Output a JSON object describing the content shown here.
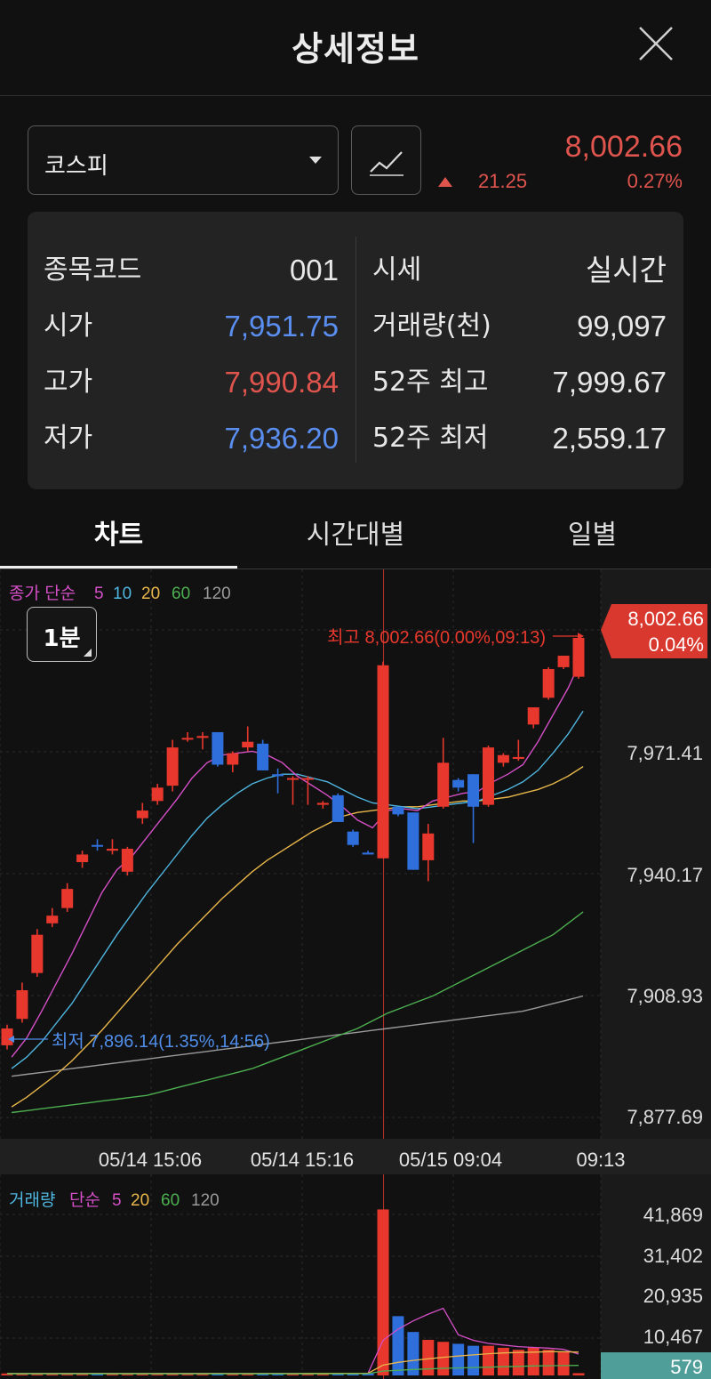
{
  "header": {
    "title": "상세정보"
  },
  "selector": {
    "index_name": "코스피"
  },
  "quote": {
    "price": "8,002.66",
    "change": "21.25",
    "change_pct": "0.27%"
  },
  "info": {
    "left": [
      {
        "key": "종목코드",
        "value": "001",
        "color": "white"
      },
      {
        "key": "시가",
        "value": "7,951.75",
        "color": "blue"
      },
      {
        "key": "고가",
        "value": "7,990.84",
        "color": "red"
      },
      {
        "key": "저가",
        "value": "7,936.20",
        "color": "blue"
      }
    ],
    "right": [
      {
        "key": "시세",
        "value": "실시간"
      },
      {
        "key": "거래량(천)",
        "value": "99,097"
      },
      {
        "key": "52주 최고",
        "value": "7,999.67"
      },
      {
        "key": "52주 최저",
        "value": "2,559.17"
      }
    ]
  },
  "tabs": [
    "차트",
    "시간대별",
    "일별"
  ],
  "price_chart": {
    "legend": {
      "prefix": "종가 단순",
      "periods": [
        "5",
        "10",
        "20",
        "60",
        "120"
      ]
    },
    "period_button": "1분",
    "current": {
      "price": "8,002.66",
      "pct": "0.04%"
    },
    "high_note": "최고 8,002.66(0.00%,09:13)",
    "low_note": "최저 7,896.14(1.35%,14:56)",
    "y_ticks": [
      "7,971.41",
      "7,940.17",
      "7,908.93",
      "7,877.69"
    ],
    "x_ticks": [
      "05/14 15:06",
      "05/14 15:16",
      "05/15 09:04",
      "09:13"
    ]
  },
  "volume_chart": {
    "legend": {
      "prefix": "거래량",
      "prefix2": "단순",
      "periods": [
        "5",
        "20",
        "60",
        "120"
      ]
    },
    "y_ticks": [
      "41,869",
      "31,402",
      "20,935",
      "10,467"
    ],
    "current": "579"
  },
  "colors": {
    "up": "#e8382d",
    "down": "#2f6fdc",
    "ma5": "#d44fc6",
    "ma10": "#4fb6e0",
    "ma20": "#e8b64a",
    "ma60": "#4caf50",
    "ma120": "#9a9a9a"
  },
  "chart_data": [
    {
      "type": "candlestick",
      "title": "",
      "y_axis": {
        "min": 7877.69,
        "max": 8002.66,
        "ticks": [
          7971.41,
          7940.17,
          7908.93,
          7877.69
        ]
      },
      "x_ticks": [
        "05/14 15:06",
        "05/14 15:16",
        "05/15 09:04",
        "09:13"
      ],
      "candles": [
        {
          "o": 7896.1,
          "h": 7901.5,
          "l": 7895.0,
          "c": 7900.5
        },
        {
          "o": 7903.0,
          "h": 7912.5,
          "l": 7902.0,
          "c": 7910.5
        },
        {
          "o": 7915.0,
          "h": 7926.5,
          "l": 7914.0,
          "c": 7925.0
        },
        {
          "o": 7928.0,
          "h": 7932.0,
          "l": 7927.0,
          "c": 7930.0
        },
        {
          "o": 7932.0,
          "h": 7938.5,
          "l": 7931.0,
          "c": 7937.0
        },
        {
          "o": 7944.0,
          "h": 7947.0,
          "l": 7942.5,
          "c": 7946.0
        },
        {
          "o": 7948.5,
          "h": 7950.0,
          "l": 7947.0,
          "c": 7948.3
        },
        {
          "o": 7947.0,
          "h": 7950.0,
          "l": 7946.0,
          "c": 7947.5
        },
        {
          "o": 7941.5,
          "h": 7948.0,
          "l": 7940.5,
          "c": 7947.5
        },
        {
          "o": 7955.5,
          "h": 7959.5,
          "l": 7954.0,
          "c": 7957.5
        },
        {
          "o": 7960.0,
          "h": 7964.5,
          "l": 7959.0,
          "c": 7963.5
        },
        {
          "o": 7964.0,
          "h": 7976.0,
          "l": 7962.5,
          "c": 7974.0
        },
        {
          "o": 7976.5,
          "h": 7978.0,
          "l": 7975.5,
          "c": 7976.5
        },
        {
          "o": 7976.5,
          "h": 7978.0,
          "l": 7973.5,
          "c": 7977.0
        },
        {
          "o": 7978.0,
          "h": 7978.0,
          "l": 7969.0,
          "c": 7969.5
        },
        {
          "o": 7969.5,
          "h": 7973.0,
          "l": 7967.5,
          "c": 7972.5
        },
        {
          "o": 7974.0,
          "h": 7979.5,
          "l": 7973.0,
          "c": 7975.5
        },
        {
          "o": 7975.0,
          "h": 7976.0,
          "l": 7968.0,
          "c": 7968.0
        },
        {
          "o": 7967.0,
          "h": 7968.5,
          "l": 7962.0,
          "c": 7966.5
        },
        {
          "o": 7966.0,
          "h": 7966.5,
          "l": 7959.0,
          "c": 7966.0
        },
        {
          "o": 7966.0,
          "h": 7966.5,
          "l": 7959.0,
          "c": 7966.0
        },
        {
          "o": 7959.0,
          "h": 7960.0,
          "l": 7958.0,
          "c": 7959.5
        },
        {
          "o": 7961.5,
          "h": 7962.0,
          "l": 7954.5,
          "c": 7954.5
        },
        {
          "o": 7952.0,
          "h": 7952.5,
          "l": 7948.0,
          "c": 7948.5
        },
        {
          "o": 7946.5,
          "h": 7947.0,
          "l": 7946.0,
          "c": 7946.0
        },
        {
          "o": 7945.0,
          "h": 7996.5,
          "l": 7945.0,
          "c": 7995.5
        },
        {
          "o": 7958.5,
          "h": 7958.5,
          "l": 7956.0,
          "c": 7956.5
        },
        {
          "o": 7957.0,
          "h": 7957.0,
          "l": 7942.0,
          "c": 7942.0
        },
        {
          "o": 7944.5,
          "h": 7954.0,
          "l": 7939.0,
          "c": 7951.5
        },
        {
          "o": 7958.5,
          "h": 7976.5,
          "l": 7958.0,
          "c": 7970.0
        },
        {
          "o": 7965.5,
          "h": 7966.0,
          "l": 7962.5,
          "c": 7963.5
        },
        {
          "o": 7967.0,
          "h": 7967.0,
          "l": 7949.0,
          "c": 7958.5
        },
        {
          "o": 7959.0,
          "h": 7974.5,
          "l": 7958.5,
          "c": 7974.0
        },
        {
          "o": 7970.0,
          "h": 7972.5,
          "l": 7969.0,
          "c": 7972.0
        },
        {
          "o": 7971.0,
          "h": 7976.0,
          "l": 7970.5,
          "c": 7971.5
        },
        {
          "o": 7980.0,
          "h": 7984.5,
          "l": 7979.0,
          "c": 7984.5
        },
        {
          "o": 7987.0,
          "h": 7995.0,
          "l": 7986.5,
          "c": 7994.5
        },
        {
          "o": 7995.0,
          "h": 7998.0,
          "l": 7994.5,
          "c": 7998.0
        },
        {
          "o": 7992.5,
          "h": 8002.66,
          "l": 7992.0,
          "c": 8002.66
        }
      ],
      "series": [
        {
          "name": "5",
          "values": [
            7893.0,
            7898.0,
            7905.0,
            7912.5,
            7920.0,
            7928.0,
            7936.0,
            7942.0,
            7945.5,
            7950.5,
            7955.5,
            7960.5,
            7966.0,
            7970.0,
            7972.0,
            7972.5,
            7973.0,
            7972.0,
            7970.0,
            7966.5,
            7964.0,
            7961.5,
            7958.5,
            7955.0,
            7953.0,
            7957.5,
            7958.0,
            7957.5,
            7960.0,
            7961.0,
            7962.0,
            7962.5,
            7965.0,
            7967.0,
            7969.5,
            7975.5,
            7982.5,
            7989.5,
            7998.0
          ]
        },
        {
          "name": "10",
          "values": [
            7890.0,
            7893.0,
            7897.0,
            7902.0,
            7907.0,
            7913.0,
            7919.0,
            7925.0,
            7930.5,
            7936.0,
            7941.0,
            7946.0,
            7951.0,
            7955.5,
            7959.0,
            7962.0,
            7964.5,
            7966.0,
            7967.0,
            7967.0,
            7966.0,
            7965.0,
            7963.0,
            7961.0,
            7959.5,
            7959.0,
            7958.5,
            7958.0,
            7958.5,
            7959.0,
            7959.5,
            7960.0,
            7961.5,
            7963.0,
            7965.0,
            7968.0,
            7972.5,
            7977.5,
            7983.5
          ]
        },
        {
          "name": "20",
          "values": [
            7880.0,
            7882.5,
            7885.5,
            7888.5,
            7892.0,
            7896.0,
            7900.0,
            7904.5,
            7909.0,
            7913.5,
            7918.0,
            7922.5,
            7926.5,
            7930.5,
            7934.5,
            7938.0,
            7941.5,
            7944.5,
            7947.0,
            7949.5,
            7952.0,
            7954.0,
            7956.0,
            7957.0,
            7957.5,
            7958.0,
            7958.5,
            7958.5,
            7959.0,
            7959.5,
            7960.0,
            7960.0,
            7960.5,
            7961.0,
            7962.0,
            7963.0,
            7964.5,
            7966.5,
            7969.0
          ]
        },
        {
          "name": "60",
          "values": [
            7878.5,
            7879.0,
            7879.5,
            7880.0,
            7880.5,
            7881.0,
            7881.5,
            7882.0,
            7882.5,
            7883.0,
            7884.0,
            7885.0,
            7886.0,
            7887.0,
            7888.0,
            7889.0,
            7890.0,
            7891.5,
            7893.0,
            7894.5,
            7896.0,
            7897.5,
            7899.0,
            7900.5,
            7902.5,
            7904.5,
            7906.0,
            7907.5,
            7909.0,
            7911.0,
            7913.0,
            7915.0,
            7917.0,
            7919.0,
            7921.0,
            7923.0,
            7925.0,
            7928.0,
            7931.0
          ]
        },
        {
          "name": "120",
          "values": [
            7888.0,
            7888.5,
            7889.0,
            7889.5,
            7890.0,
            7890.5,
            7891.0,
            7891.5,
            7892.0,
            7892.5,
            7893.0,
            7893.5,
            7894.0,
            7894.5,
            7895.0,
            7895.5,
            7896.0,
            7896.5,
            7897.0,
            7897.5,
            7898.0,
            7898.5,
            7899.0,
            7899.5,
            7900.0,
            7900.5,
            7901.0,
            7901.5,
            7902.0,
            7902.5,
            7903.0,
            7903.5,
            7904.0,
            7904.5,
            7905.0,
            7906.0,
            7907.0,
            7908.0,
            7909.0
          ]
        }
      ]
    },
    {
      "type": "bar",
      "title": "",
      "y_axis": {
        "min": 0,
        "max": 41869,
        "ticks": [
          41869,
          31402,
          20935,
          10467
        ]
      },
      "values": [
        500,
        500,
        500,
        600,
        500,
        500,
        500,
        500,
        500,
        500,
        500,
        600,
        500,
        500,
        500,
        500,
        500,
        500,
        500,
        500,
        500,
        500,
        500,
        600,
        600,
        42000,
        15000,
        11000,
        9000,
        8500,
        8000,
        7500,
        7500,
        7000,
        6500,
        7000,
        6500,
        6000,
        579
      ],
      "series": [
        {
          "name": "5",
          "values": [
            500,
            500,
            500,
            520,
            520,
            520,
            520,
            520,
            500,
            500,
            520,
            520,
            520,
            520,
            520,
            500,
            500,
            500,
            500,
            500,
            500,
            500,
            520,
            540,
            560,
            8900,
            11700,
            13800,
            15500,
            17000,
            10300,
            8900,
            8100,
            7700,
            7300,
            7100,
            6900,
            6600,
            5400
          ]
        },
        {
          "name": "20",
          "values": [
            500,
            500,
            500,
            500,
            500,
            500,
            500,
            500,
            500,
            500,
            500,
            500,
            500,
            500,
            500,
            500,
            500,
            500,
            500,
            500,
            510,
            510,
            520,
            530,
            550,
            2600,
            3300,
            3800,
            4200,
            4600,
            4900,
            5200,
            5500,
            5700,
            5800,
            5900,
            6000,
            6000,
            5900
          ]
        },
        {
          "name": "60",
          "values": [
            400,
            400,
            400,
            400,
            400,
            400,
            400,
            400,
            400,
            400,
            400,
            400,
            400,
            400,
            400,
            400,
            400,
            400,
            400,
            400,
            400,
            400,
            420,
            430,
            440,
            1100,
            1300,
            1500,
            1650,
            1800,
            1900,
            2000,
            2100,
            2200,
            2300,
            2400,
            2450,
            2500,
            2550
          ]
        }
      ]
    }
  ]
}
